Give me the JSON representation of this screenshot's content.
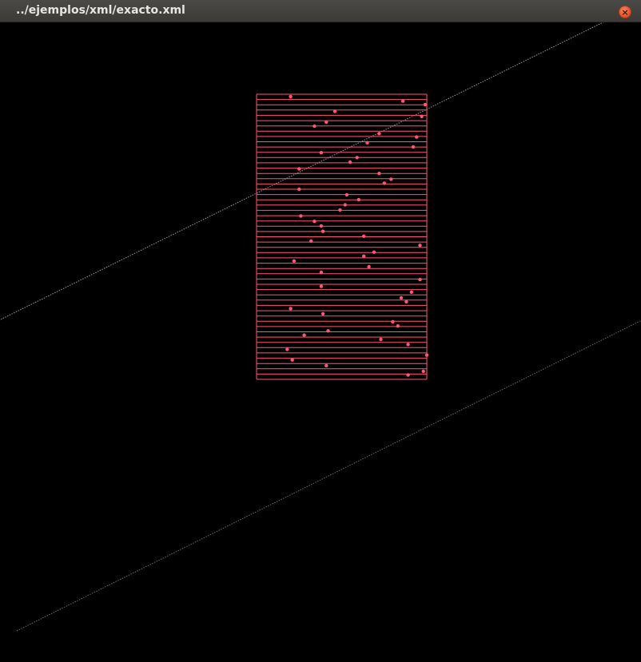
{
  "window": {
    "title": "../ejemplos/xml/exacto.xml",
    "close_glyph": "×",
    "close_icon": "close-icon"
  },
  "scene": {
    "colors": {
      "background": "#000000",
      "lines": "#ff5577",
      "points": "#ff5577",
      "diagonal_upper": "#9a9a9a",
      "diagonal_lower": "#6a6a6a"
    },
    "line_count": 55,
    "points": [
      [
        0.2,
        0.008
      ],
      [
        0.86,
        0.024
      ],
      [
        0.99,
        0.036
      ],
      [
        0.46,
        0.06
      ],
      [
        0.97,
        0.078
      ],
      [
        0.41,
        0.098
      ],
      [
        0.34,
        0.112
      ],
      [
        0.72,
        0.138
      ],
      [
        0.94,
        0.15
      ],
      [
        0.65,
        0.17
      ],
      [
        0.92,
        0.185
      ],
      [
        0.38,
        0.205
      ],
      [
        0.59,
        0.222
      ],
      [
        0.55,
        0.238
      ],
      [
        0.25,
        0.262
      ],
      [
        0.72,
        0.278
      ],
      [
        0.79,
        0.298
      ],
      [
        0.75,
        0.312
      ],
      [
        0.25,
        0.333
      ],
      [
        0.53,
        0.353
      ],
      [
        0.6,
        0.37
      ],
      [
        0.52,
        0.388
      ],
      [
        0.49,
        0.406
      ],
      [
        0.26,
        0.427
      ],
      [
        0.34,
        0.446
      ],
      [
        0.38,
        0.462
      ],
      [
        0.39,
        0.481
      ],
      [
        0.63,
        0.498
      ],
      [
        0.32,
        0.515
      ],
      [
        0.96,
        0.53
      ],
      [
        0.69,
        0.554
      ],
      [
        0.63,
        0.568
      ],
      [
        0.22,
        0.585
      ],
      [
        0.66,
        0.605
      ],
      [
        0.38,
        0.625
      ],
      [
        0.96,
        0.65
      ],
      [
        0.38,
        0.674
      ],
      [
        0.91,
        0.694
      ],
      [
        0.85,
        0.714
      ],
      [
        0.88,
        0.728
      ],
      [
        0.2,
        0.752
      ],
      [
        0.39,
        0.77
      ],
      [
        0.8,
        0.798
      ],
      [
        0.83,
        0.813
      ],
      [
        0.42,
        0.83
      ],
      [
        0.28,
        0.845
      ],
      [
        0.73,
        0.86
      ],
      [
        0.89,
        0.878
      ],
      [
        0.18,
        0.895
      ],
      [
        1.0,
        0.915
      ],
      [
        0.21,
        0.932
      ],
      [
        0.41,
        0.952
      ],
      [
        0.98,
        0.972
      ],
      [
        0.89,
        0.985
      ]
    ]
  }
}
